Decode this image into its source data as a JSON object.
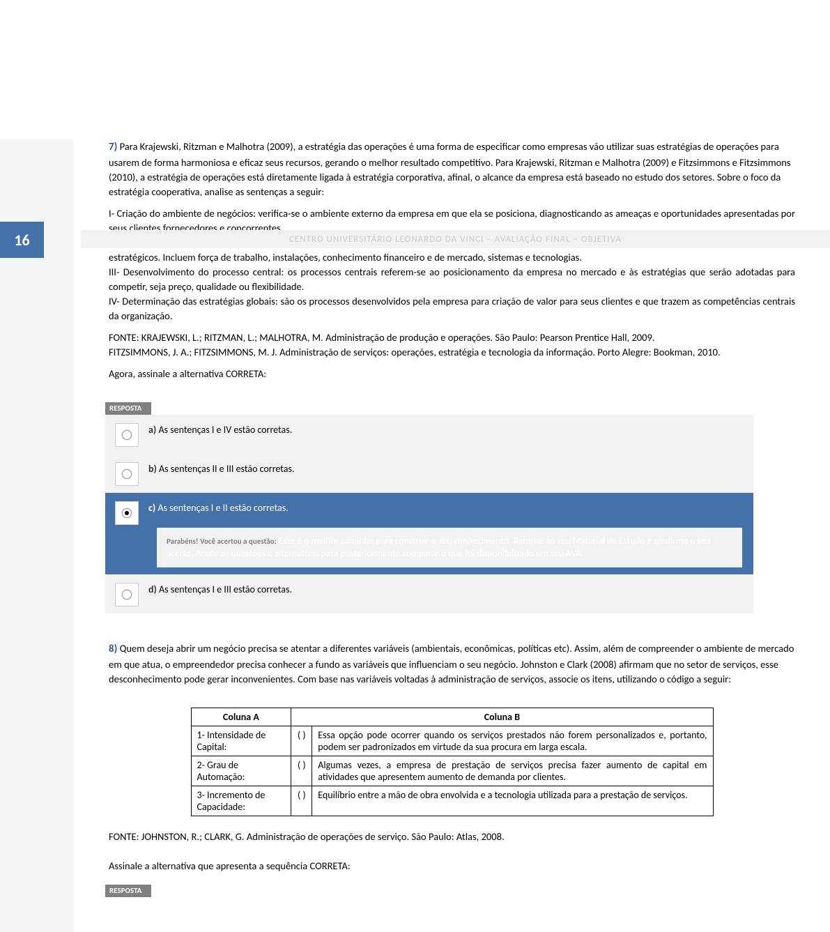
{
  "page": {
    "number": "16",
    "header": "CENTRO UNIVERSITÁRIO LEONARDO DA VINCI – AVALIAÇÃO FINAL – OBJETIVA"
  },
  "q7": {
    "label": "7)",
    "text": "Para Krajewski, Ritzman e Malhotra (2009), a estratégia das operações é uma forma de especificar como empresas vão utilizar suas estratégias de operações para usarem de forma harmoniosa e eficaz seus recursos, gerando o melhor resultado competitivo. Para Krajewski, Ritzman e Malhotra (2009) e Fitzsimmons e Fitzsimmons (2010), a estratégia de operações está diretamente ligada à estratégia corporativa, afinal, o alcance da empresa está baseado no estudo dos setores. Sobre o foco da estratégia cooperativa, analise as sentenças a seguir:",
    "items": [
      "I- Criação do ambiente de negócios: verifica-se o ambiente externo da empresa em que ela se posiciona, diagnosticando as ameaças e oportunidades apresentadas por seus clientes fornecedores e concorrentes.",
      "II- Avaliação das competências centrais: essas competências refletem o processo de aprendizagem coletivo que a empresa deve possuir para atingir seus objetivos estratégicos. Incluem força de trabalho, instalações, conhecimento financeiro e de mercado, sistemas e tecnologias.",
      "III- Desenvolvimento do processo central: os processos centrais referem-se ao posicionamento da empresa no mercado e às estratégias que serão adotadas para competir, seja preço, qualidade ou flexibilidade.",
      "IV- Determinação das estratégias globais: são os processos desenvolvidos pela empresa para criação de valor para seus clientes e que trazem as competências centrais da organização."
    ],
    "sources": [
      "FONTE: KRAJEWSKI, L.; RITZMAN, L.; MALHOTRA, M. Administração de produção e operações. São Paulo: Pearson Prentice Hall, 2009.",
      "FITZSIMMONS, J. A.; FITZSIMMONS, M. J. Administração de serviços: operações, estratégia e tecnologia da informação. Porto Alegre: Bookman, 2010."
    ],
    "prompt": "Agora, assinale a alternativa CORRETA:",
    "answer_header": "RESPOSTA",
    "options": [
      {
        "key": "a",
        "text": "As sentenças I e IV estão corretas.",
        "selected": false
      },
      {
        "key": "b",
        "text": "As sentenças II e III estão corretas.",
        "selected": false
      },
      {
        "key": "c",
        "text": "As sentenças I e II estão corretas.",
        "selected": true
      },
      {
        "key": "d",
        "text": "As sentenças I e III estão corretas.",
        "selected": false
      }
    ],
    "feedback_label": "Parabéns! Você acertou a questão:",
    "feedback_text": "Esse é o melhor caminho para construir o seu conhecimento. Retorne ao seu Material de Estudo e confirme o seu acerto. Anote as questões e alternativas para posteriormente comparar o que foi disponibilizado em seu AVA."
  },
  "q8": {
    "label": "8)",
    "text": "Quem deseja abrir um negócio precisa se atentar a diferentes variáveis (ambientais, econômicas, políticas etc). Assim, além de compreender o ambiente de mercado em que atua, o empreendedor precisa conhecer a fundo as variáveis que influenciam o seu negócio. Johnston e Clark (2008) afirmam que no setor de serviços, esse desconhecimento pode gerar inconvenientes. Com base nas variáveis voltadas à administração de serviços, associe os itens, utilizando o código a seguir:",
    "table": {
      "col_a": "Coluna A",
      "col_b": "Coluna B",
      "rows": [
        {
          "a": "1- Intensidade de Capital:",
          "p": "(  )",
          "b": "Essa opção pode ocorrer quando os serviços prestados não forem personalizados e, portanto, podem ser padronizados em virtude da sua procura em larga escala."
        },
        {
          "a": "2- Grau de Automação:",
          "p": "(  )",
          "b": "Algumas vezes, a empresa de prestação de serviços precisa fazer aumento de capital em atividades que apresentem aumento de demanda por clientes."
        },
        {
          "a": "3- Incremento de Capacidade:",
          "p": "(  )",
          "b": "Equilíbrio entre a mão de obra envolvida e a tecnologia utilizada para a prestação de serviços."
        }
      ]
    },
    "source": "FONTE: JOHNSTON, R.; CLARK, G. Administração de operações de serviço. São Paulo: Atlas, 2008.",
    "prompt": "Assinale a alternativa que apresenta a sequência CORRETA:",
    "answer_header": "RESPOSTA"
  }
}
